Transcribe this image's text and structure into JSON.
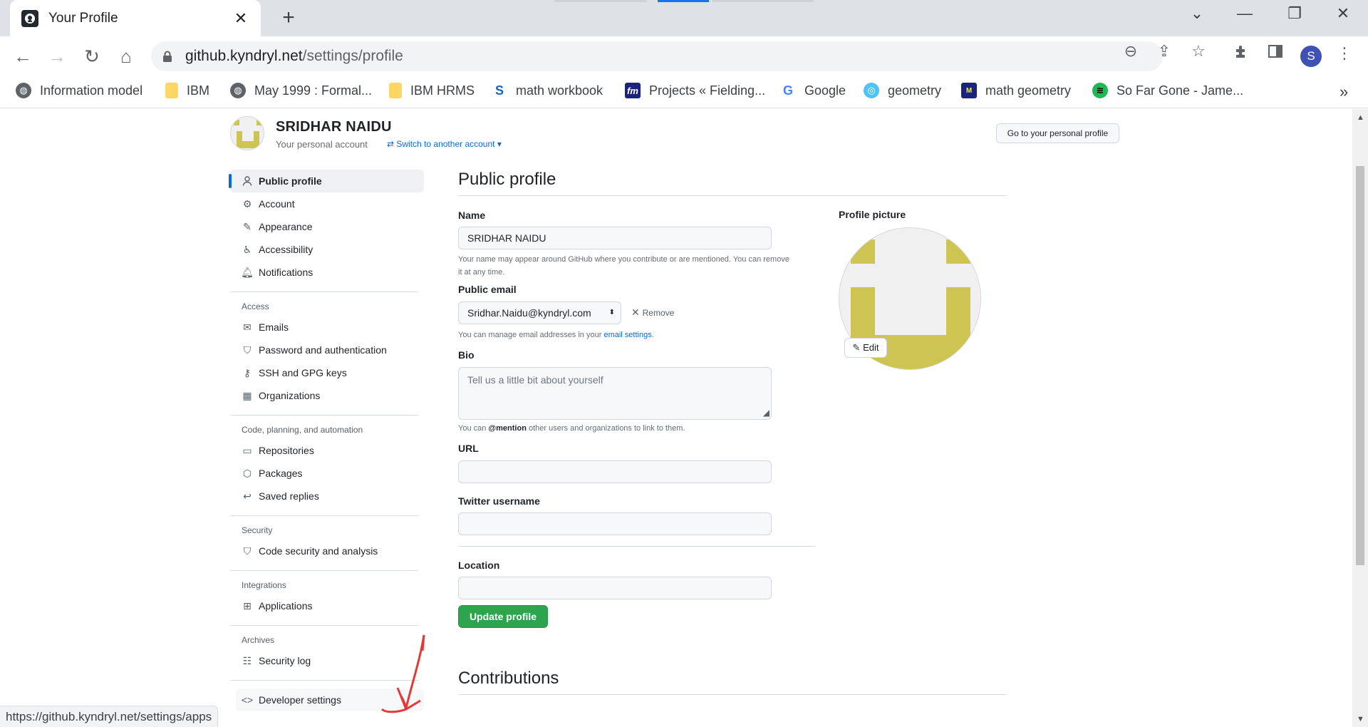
{
  "browser": {
    "tab_title": "Your Profile",
    "url_host": "github.kyndryl.net",
    "url_path": "/settings/profile",
    "profile_initial": "S",
    "status_url": "https://github.kyndryl.net/settings/apps"
  },
  "bookmarks": [
    {
      "label": "Information model",
      "icon": "globe-icon"
    },
    {
      "label": "IBM",
      "icon": "folder-icon"
    },
    {
      "label": "May 1999 : Formal...",
      "icon": "globe-icon"
    },
    {
      "label": "IBM HRMS",
      "icon": "folder-icon"
    },
    {
      "label": "math workbook",
      "icon": "s-logo-icon"
    },
    {
      "label": "Projects « Fielding...",
      "icon": "fm-logo-icon"
    },
    {
      "label": "Google",
      "icon": "google-icon"
    },
    {
      "label": "geometry",
      "icon": "geometry-icon"
    },
    {
      "label": "math geometry",
      "icon": "math-logo-icon"
    },
    {
      "label": "So Far Gone - Jame...",
      "icon": "spotify-icon"
    }
  ],
  "account": {
    "name": "SRIDHAR NAIDU",
    "subtitle": "Your personal account",
    "switch_label": "Switch to another account",
    "go_profile_label": "Go to your personal profile"
  },
  "sidebar": {
    "items_top": [
      {
        "label": "Public profile",
        "icon": "person-icon",
        "active": true
      },
      {
        "label": "Account",
        "icon": "gear-icon"
      },
      {
        "label": "Appearance",
        "icon": "paintbrush-icon"
      },
      {
        "label": "Accessibility",
        "icon": "accessibility-icon"
      },
      {
        "label": "Notifications",
        "icon": "bell-icon"
      }
    ],
    "access_heading": "Access",
    "access_items": [
      {
        "label": "Emails",
        "icon": "mail-icon"
      },
      {
        "label": "Password and authentication",
        "icon": "shield-lock-icon"
      },
      {
        "label": "SSH and GPG keys",
        "icon": "key-icon"
      },
      {
        "label": "Organizations",
        "icon": "organization-icon"
      }
    ],
    "code_heading": "Code, planning, and automation",
    "code_items": [
      {
        "label": "Repositories",
        "icon": "repo-icon"
      },
      {
        "label": "Packages",
        "icon": "package-icon"
      },
      {
        "label": "Saved replies",
        "icon": "reply-icon"
      }
    ],
    "security_heading": "Security",
    "security_items": [
      {
        "label": "Code security and analysis",
        "icon": "shield-lock-icon"
      }
    ],
    "integrations_heading": "Integrations",
    "integrations_items": [
      {
        "label": "Applications",
        "icon": "apps-icon"
      }
    ],
    "archives_heading": "Archives",
    "archives_items": [
      {
        "label": "Security log",
        "icon": "log-icon"
      }
    ],
    "developer_label": "Developer settings"
  },
  "profile": {
    "heading": "Public profile",
    "name_label": "Name",
    "name_value": "SRIDHAR NAIDU",
    "name_note": "Your name may appear around GitHub where you contribute or are mentioned. You can remove it at any time.",
    "email_label": "Public email",
    "email_value": "Sridhar.Naidu@kyndryl.com",
    "remove_label": "Remove",
    "email_note_pre": "You can manage email addresses in your",
    "email_note_link": "email settings",
    "email_note_post": ".",
    "bio_label": "Bio",
    "bio_placeholder": "Tell us a little bit about yourself",
    "bio_note_pre": "You can",
    "bio_note_mention": "@mention",
    "bio_note_post": "other users and organizations to link to them.",
    "url_label": "URL",
    "url_value": "",
    "twitter_label": "Twitter username",
    "twitter_value": "",
    "location_label": "Location",
    "location_value": "",
    "update_label": "Update profile",
    "picture_label": "Profile picture",
    "edit_label": "Edit",
    "contributions_heading": "Contributions"
  },
  "colors": {
    "accent": "#0969da",
    "primary_button": "#2da44e",
    "avatar_identicon": "#cdc451",
    "annotation": "#e53935"
  }
}
